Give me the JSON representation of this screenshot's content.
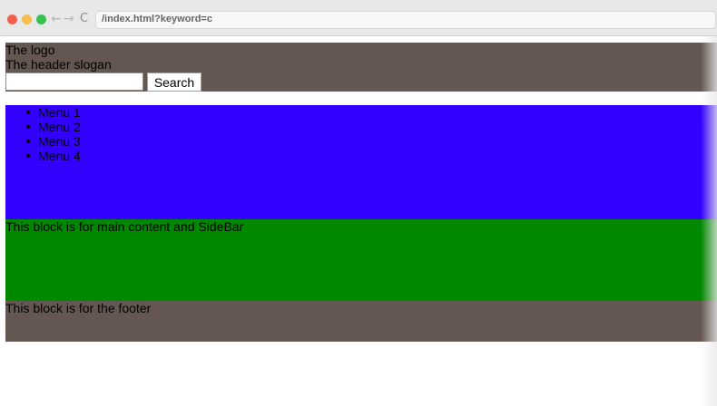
{
  "browser": {
    "address": "/index.html?keyword=c",
    "back_icon": "←",
    "forward_icon": "→",
    "reload_icon": "C"
  },
  "header": {
    "logo": "The logo",
    "slogan": "The header slogan",
    "search_value": "",
    "search_button": "Search",
    "background_color": "#645752"
  },
  "menu": {
    "items": [
      "Menu 1",
      "Menu 2",
      "Menu 3",
      "Menu 4"
    ],
    "background_color": "#3300ff"
  },
  "main": {
    "text": "This block is for main content and SideBar",
    "background_color": "#008800"
  },
  "footer": {
    "text": "This block is for the footer",
    "background_color": "#645752"
  }
}
